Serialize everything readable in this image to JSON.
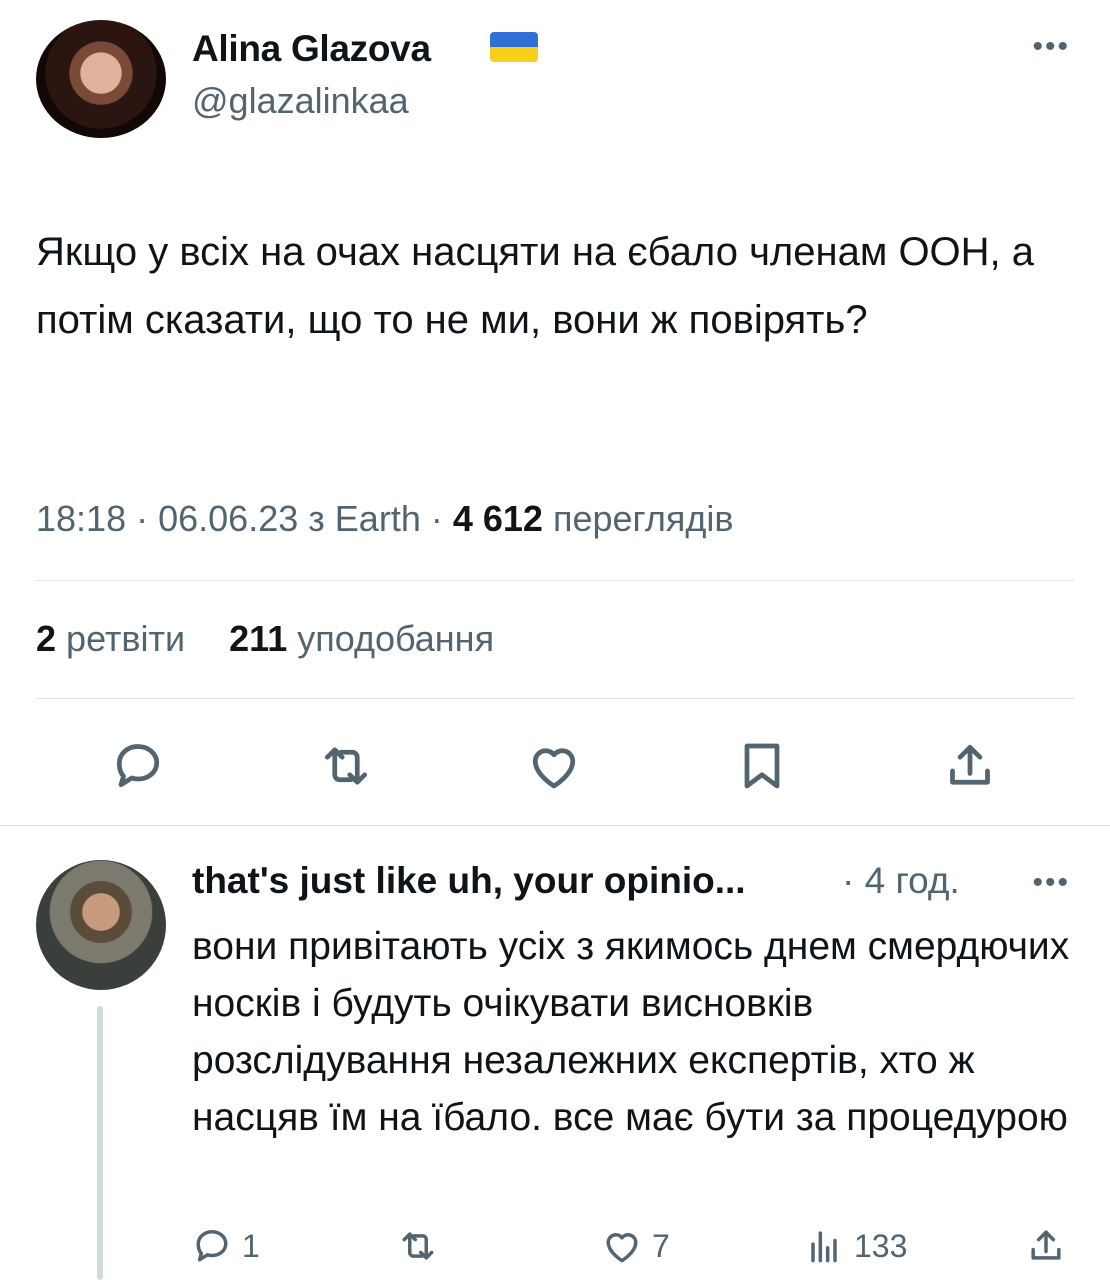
{
  "tweet": {
    "author_name": "Alina Glazova",
    "handle": "@glazalinkaa",
    "text": "Якщо у всіх на очах насцяти на єбало членам ООН, а потім сказати, що то не ми, вони ж повірять?",
    "time": "18:18",
    "date": "06.06.23",
    "source_prefix": "з",
    "source": "Earth",
    "views_count": "4 612",
    "views_label": "переглядів",
    "retweets_count": "2",
    "retweets_label": "ретвіти",
    "likes_count": "211",
    "likes_label": "уподобання",
    "more_label": "•••"
  },
  "reply": {
    "author_name": "that's just like uh, your opinio...",
    "time": "4 год.",
    "more_label": "•••",
    "text": "вони привітають усіх з якимось днем смердючих носків і будуть очікувати висновків розслідування незалежних експертів, хто ж насцяв їм на їбало. все має бути за процедурою",
    "replies_count": "1",
    "likes_count": "7",
    "views_count": "133"
  },
  "colors": {
    "text_primary": "#0f1419",
    "text_secondary": "#536471",
    "divider": "#dfe3e7",
    "thread_line": "#cfd9de",
    "flag_blue": "#2f6fd6",
    "flag_yellow": "#f7d117"
  },
  "icons": {
    "tweet_actions": [
      "reply-icon",
      "retweet-icon",
      "like-icon",
      "bookmark-icon",
      "share-icon"
    ],
    "reply_actions": [
      "reply-icon",
      "retweet-icon",
      "like-icon",
      "views-icon",
      "share-icon"
    ],
    "author_badge": "ukraine-flag-icon"
  }
}
